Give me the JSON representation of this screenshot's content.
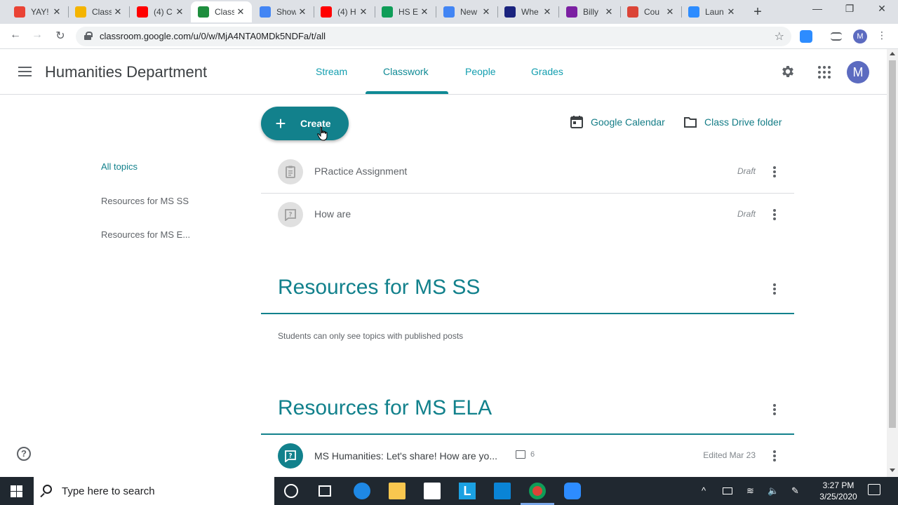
{
  "browser": {
    "tabs": [
      {
        "title": "YAY!",
        "icon": "gmail-icon",
        "color": "#ea4335"
      },
      {
        "title": "Classroom",
        "icon": "classroom-icon",
        "color": "#f4b400"
      },
      {
        "title": "(4) C",
        "icon": "youtube-icon",
        "color": "#ff0000"
      },
      {
        "title": "Classwork",
        "icon": "classroom-icon",
        "color": "#1e8e3e"
      },
      {
        "title": "Show",
        "icon": "docs-icon",
        "color": "#4285f4"
      },
      {
        "title": "(4) H",
        "icon": "youtube-icon",
        "color": "#ff0000"
      },
      {
        "title": "HS E",
        "icon": "drive-icon",
        "color": "#0f9d58"
      },
      {
        "title": "New",
        "icon": "calendar-icon",
        "color": "#4285f4"
      },
      {
        "title": "Whe",
        "icon": "vectorworks-icon",
        "color": "#1a237e"
      },
      {
        "title": "Billy",
        "icon": "pear-deck-icon",
        "color": "#7b1fa2"
      },
      {
        "title": "Cou",
        "icon": "course-icon",
        "color": "#db4437"
      },
      {
        "title": "Laun",
        "icon": "zoom-icon",
        "color": "#2d8cff"
      }
    ],
    "url": "classroom.google.com/u/0/w/MjA4NTA0MDk5NDFa/t/all",
    "profile_initial": "M"
  },
  "header": {
    "class_name": "Humanities Department",
    "tabs": [
      "Stream",
      "Classwork",
      "People",
      "Grades"
    ],
    "active_tab": "Classwork",
    "avatar_initial": "M",
    "accent": "#12818c"
  },
  "toolbar": {
    "create_label": "Create",
    "calendar_label": "Google Calendar",
    "drive_label": "Class Drive folder"
  },
  "topics": {
    "items": [
      "All topics",
      "Resources for MS SS",
      "Resources for MS E..."
    ]
  },
  "no_topic_items": [
    {
      "title": "PRactice Assignment",
      "status": "Draft",
      "icon": "assignment-icon"
    },
    {
      "title": "How are",
      "status": "Draft",
      "icon": "question-icon"
    }
  ],
  "sections": [
    {
      "title": "Resources for MS SS",
      "empty_message": "Students can only see topics with published posts"
    },
    {
      "title": "Resources for MS ELA",
      "items": [
        {
          "title": "MS Humanities: Let's share! How are yo...",
          "comments": "6",
          "status": "Edited Mar 23",
          "icon": "question-icon"
        }
      ]
    }
  ],
  "taskbar": {
    "search_placeholder": "Type here to search",
    "time": "3:27 PM",
    "date": "3/25/2020"
  }
}
